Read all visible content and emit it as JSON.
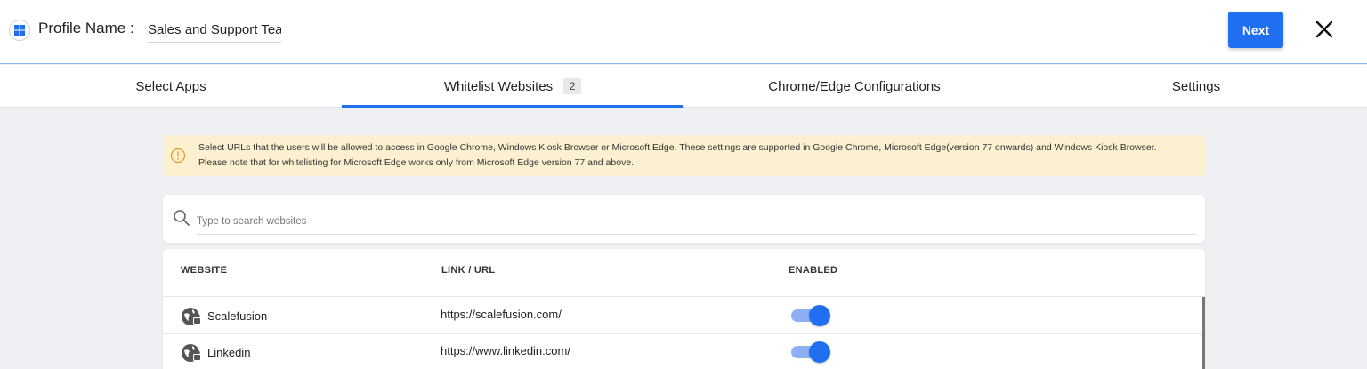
{
  "header": {
    "profile_label": "Profile Name :",
    "profile_value": "Sales and Support Tea",
    "next_label": "Next"
  },
  "tabs": [
    {
      "label": "Select Apps",
      "active": false
    },
    {
      "label": "Whitelist Websites",
      "badge": "2",
      "active": true
    },
    {
      "label": "Chrome/Edge Configurations",
      "active": false
    },
    {
      "label": "Settings",
      "active": false
    }
  ],
  "info": {
    "text": "Select URLs that the users will be allowed to access in Google Chrome, Windows Kiosk Browser or Microsoft Edge. These settings are supported in Google Chrome, Microsoft Edge(version 77 onwards) and Windows Kiosk Browser. Please note that for whitelisting for Microsoft Edge works only from Microsoft Edge version 77 and above."
  },
  "search": {
    "placeholder": "Type to search websites",
    "value": ""
  },
  "table": {
    "headers": [
      "WEBSITE",
      "LINK / URL",
      "ENABLED"
    ],
    "rows": [
      {
        "name": "Scalefusion",
        "url": "https://scalefusion.com/",
        "enabled": true
      },
      {
        "name": "Linkedin",
        "url": "https://www.linkedin.com/",
        "enabled": true
      }
    ]
  },
  "colors": {
    "accent": "#1f6ff0",
    "toggle_track": "#8cb0f3",
    "banner_bg": "#fbf0cf",
    "banner_icon": "#e89a2c"
  },
  "icons": {
    "profile": "windows-logo-icon",
    "close": "close-icon",
    "info": "info-icon",
    "search": "search-icon",
    "site": "globe-lock-icon"
  }
}
